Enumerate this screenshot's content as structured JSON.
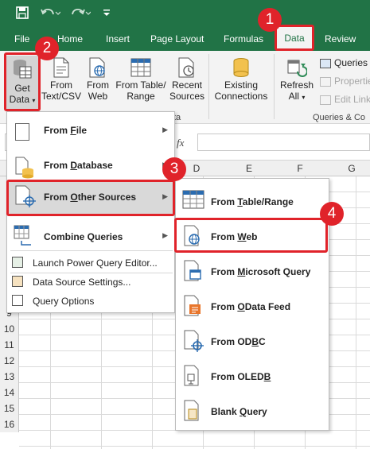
{
  "titlebar": {
    "save_icon": "save-icon",
    "undo_icon": "undo-icon",
    "redo_icon": "redo-icon",
    "customize_icon": "customize-qat-icon"
  },
  "tabs": [
    {
      "label": "File"
    },
    {
      "label": "Home"
    },
    {
      "label": "Insert"
    },
    {
      "label": "Page Layout"
    },
    {
      "label": "Formulas"
    },
    {
      "label": "Data"
    },
    {
      "label": "Review"
    }
  ],
  "ribbon": {
    "get_data_line1": "Get",
    "get_data_line2": "Data",
    "from_text_line1": "From",
    "from_text_line2": "Text/CSV",
    "from_web_line1": "From",
    "from_web_line2": "Web",
    "from_table_line1": "From Table/",
    "from_table_line2": "Range",
    "recent_line1": "Recent",
    "recent_line2": "Sources",
    "existing_line1": "Existing",
    "existing_line2": "Connections",
    "refresh_line1": "Refresh",
    "refresh_line2": "All",
    "queries": "Queries &",
    "properties": "Properties",
    "edit_links": "Edit Links",
    "group_get_partial": "ta",
    "group_queries": "Queries & Co"
  },
  "formula_bar": {
    "fx": "fx"
  },
  "columns": [
    "D",
    "E",
    "F",
    "G"
  ],
  "rows": [
    "9",
    "10",
    "11",
    "12",
    "13",
    "14",
    "15",
    "16"
  ],
  "get_data_menu": {
    "items": [
      {
        "prefix": "From ",
        "key": "F",
        "rest": "ile"
      },
      {
        "prefix": "From ",
        "key": "D",
        "rest": "atabase"
      },
      {
        "prefix": "From ",
        "key": "O",
        "rest": "ther Sources"
      },
      {
        "prefix": "",
        "key": "",
        "rest": "Combine Queries"
      }
    ],
    "launch": "Launch Power Query Editor...",
    "settings": "Data Source Settings...",
    "options": "Query Options"
  },
  "submenu": {
    "items": [
      {
        "prefix": "From ",
        "key": "T",
        "rest": "able/Range"
      },
      {
        "prefix": "From ",
        "key": "W",
        "rest": "eb"
      },
      {
        "prefix": "From ",
        "key": "M",
        "rest": "icrosoft Query"
      },
      {
        "prefix": "From ",
        "key": "O",
        "rest": "Data Feed"
      },
      {
        "prefix": "From OD",
        "key": "B",
        "rest": "C"
      },
      {
        "prefix": "From OLED",
        "key": "B",
        "rest": ""
      },
      {
        "prefix": "Blank ",
        "key": "Q",
        "rest": "uery"
      }
    ]
  },
  "badges": [
    "1",
    "2",
    "3",
    "4"
  ],
  "colors": {
    "excel_green": "#217346",
    "highlight_red": "#e0232a",
    "menu_selected": "#d9d9d9"
  }
}
